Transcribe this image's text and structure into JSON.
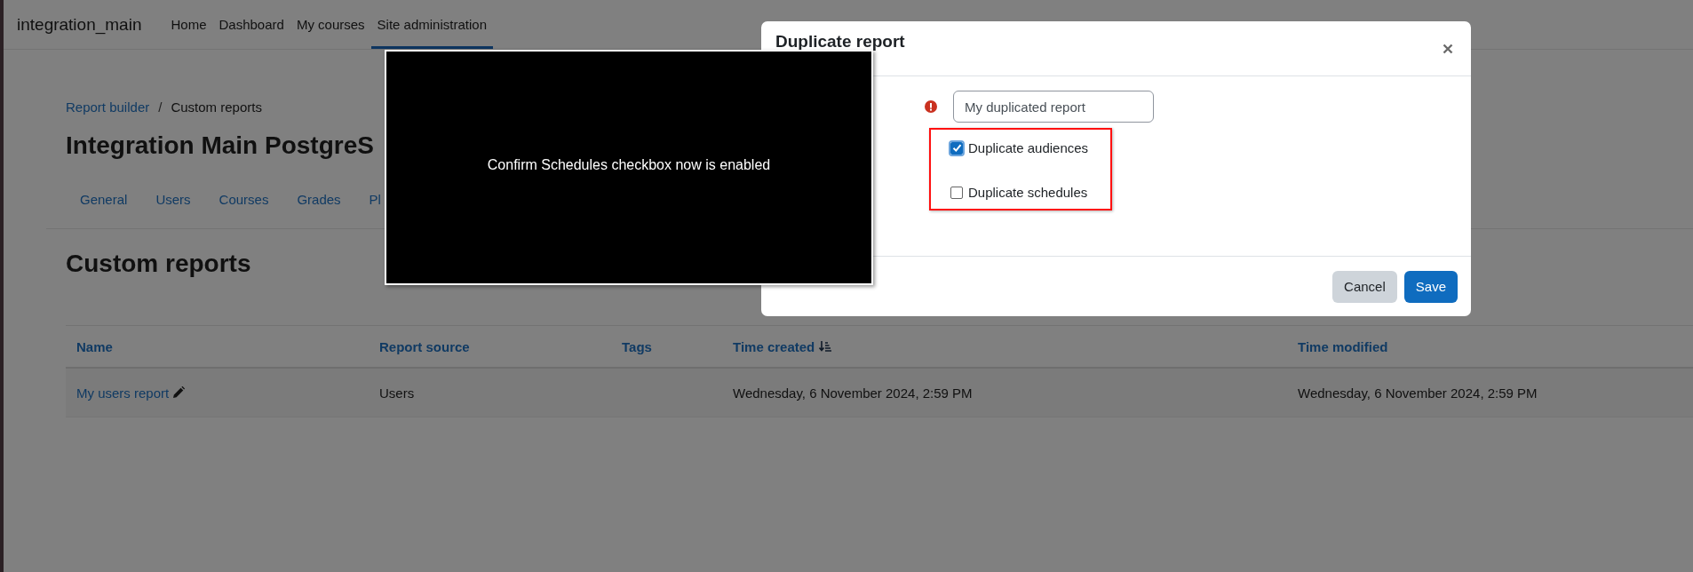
{
  "site_name": "integration_main",
  "nav": [
    {
      "label": "Home",
      "selected": false
    },
    {
      "label": "Dashboard",
      "selected": false
    },
    {
      "label": "My courses",
      "selected": false
    },
    {
      "label": "Site administration",
      "selected": true
    }
  ],
  "breadcrumb_separator": "/",
  "breadcrumb": [
    {
      "label": "Report builder",
      "kind": "link"
    },
    {
      "label": "Custom reports",
      "kind": "current"
    }
  ],
  "page_title": "Integration Main PostgreS",
  "tabs": [
    "General",
    "Users",
    "Courses",
    "Grades",
    "Pl"
  ],
  "section_title": "Custom reports",
  "table": {
    "columns": [
      {
        "label": "Name",
        "sorted": false
      },
      {
        "label": "Report source",
        "sorted": false
      },
      {
        "label": "Tags",
        "sorted": false
      },
      {
        "label": "Time created",
        "sorted": true
      },
      {
        "label": "Time modified",
        "sorted": false
      }
    ],
    "rows": [
      {
        "name": "My users report",
        "report_source": "Users",
        "time_created": "Wednesday, 6 November 2024, 2:59 PM",
        "time_modified": "Wednesday, 6 November 2024, 2:59 PM"
      }
    ]
  },
  "modal": {
    "title": "Duplicate report",
    "name_field": {
      "value": "My duplicated report",
      "required": true
    },
    "options": [
      {
        "label": "Duplicate audiences",
        "checked": true
      },
      {
        "label": "Duplicate schedules",
        "checked": false
      }
    ],
    "buttons": [
      {
        "label": "Cancel",
        "kind": "secondary"
      },
      {
        "label": "Save",
        "kind": "primary"
      }
    ]
  },
  "caption": "Confirm Schedules checkbox now is enabled"
}
